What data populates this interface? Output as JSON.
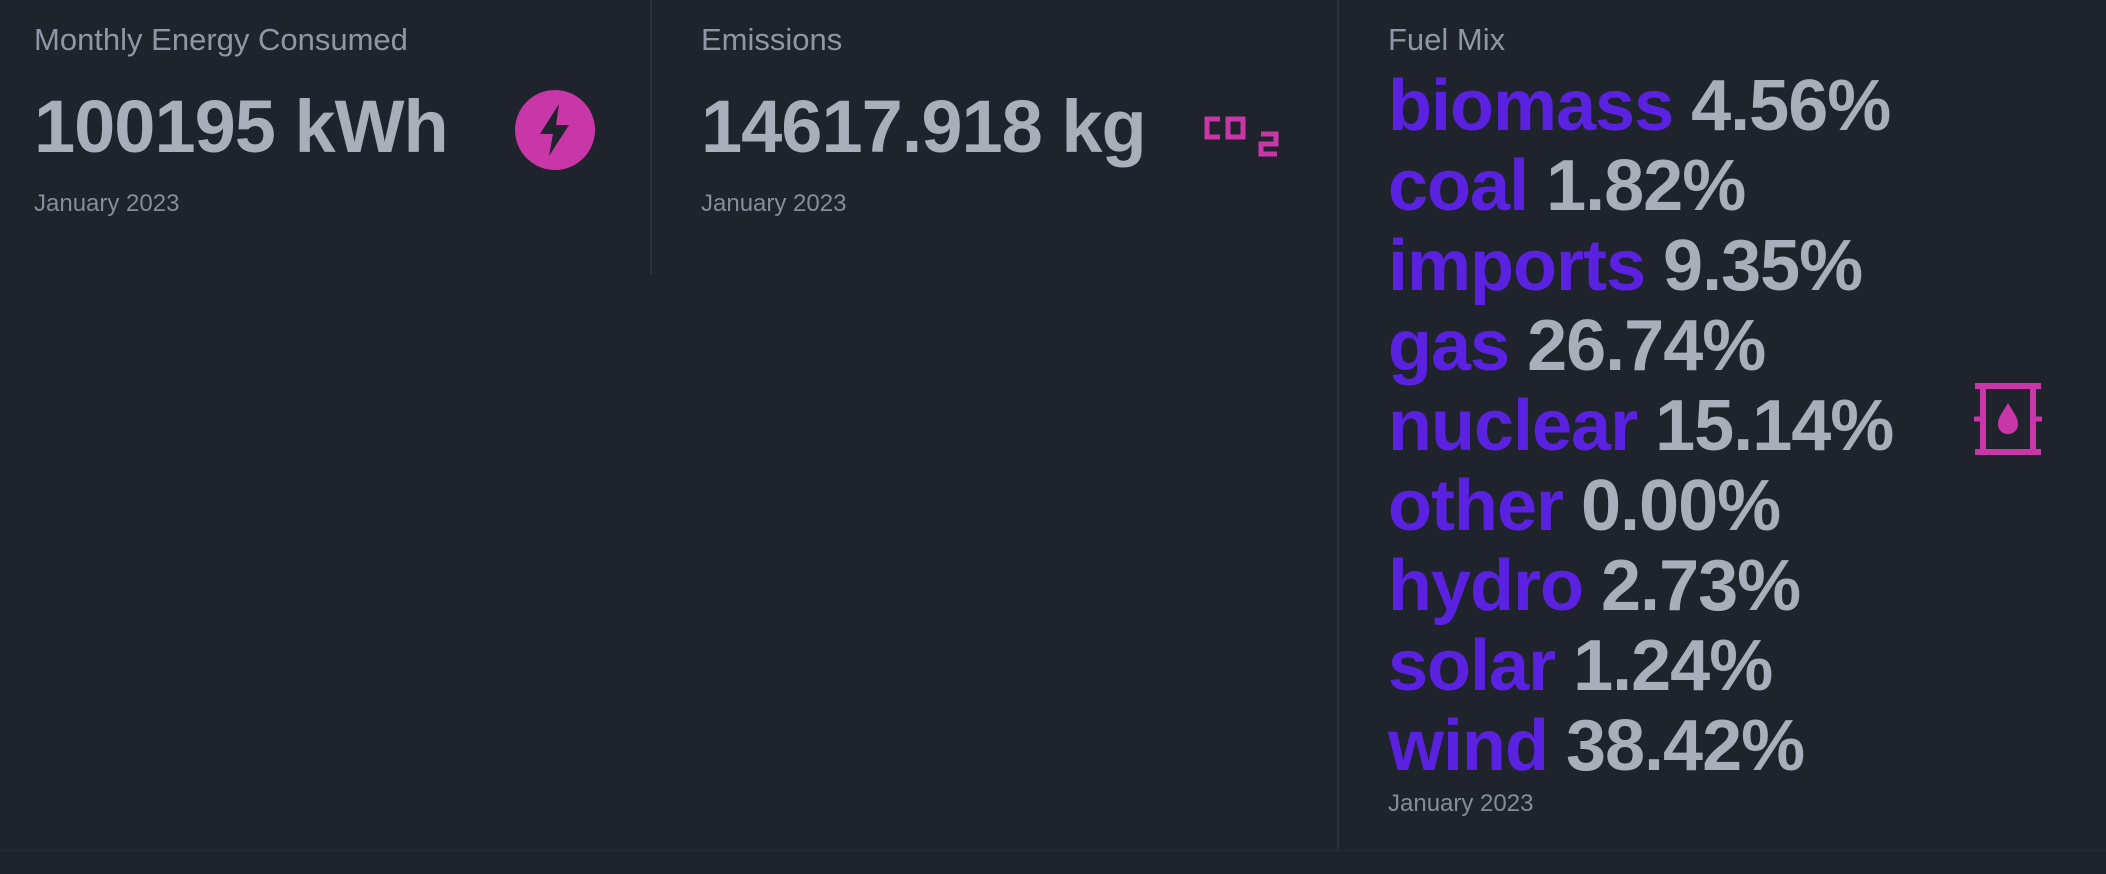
{
  "colors": {
    "background": "#1f232b",
    "accent_icon": "#c936a8",
    "fuel_name": "#5b21e0",
    "value_text": "#a9aebb"
  },
  "energy": {
    "title": "Monthly Energy Consumed",
    "value": "100195 kWh",
    "desc": "January 2023",
    "icon": "bolt-icon"
  },
  "emissions": {
    "title": "Emissions",
    "value": "14617.918 kg",
    "desc": "January 2023",
    "icon": "co2-icon"
  },
  "fuel_mix": {
    "title": "Fuel Mix",
    "desc": "January 2023",
    "icon": "oil-barrel-icon",
    "items": [
      {
        "name": "biomass",
        "pct": "4.56%"
      },
      {
        "name": "coal",
        "pct": "1.82%"
      },
      {
        "name": "imports",
        "pct": "9.35%"
      },
      {
        "name": "gas",
        "pct": "26.74%"
      },
      {
        "name": "nuclear",
        "pct": "15.14%"
      },
      {
        "name": "other",
        "pct": "0.00%"
      },
      {
        "name": "hydro",
        "pct": "2.73%"
      },
      {
        "name": "solar",
        "pct": "1.24%"
      },
      {
        "name": "wind",
        "pct": "38.42%"
      }
    ]
  }
}
